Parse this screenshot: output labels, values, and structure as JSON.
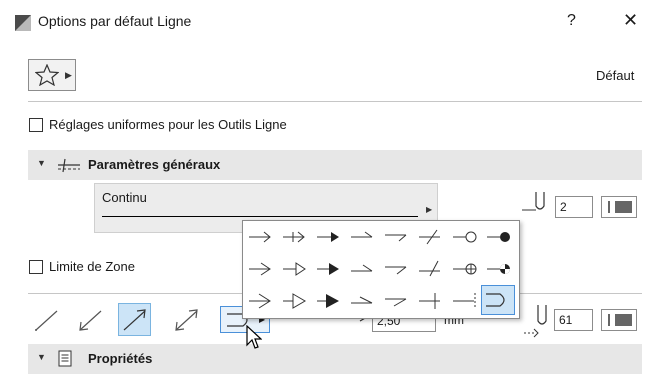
{
  "window": {
    "title": "Options par défaut Ligne",
    "help_label": "?",
    "close_label": "✕"
  },
  "favorites": {
    "icon": "star-icon"
  },
  "header": {
    "profile_label": "Défaut"
  },
  "uniform_checkbox": {
    "label": "Réglages uniformes pour les Outils Ligne",
    "checked": false
  },
  "general_section": {
    "title": "Paramètres généraux",
    "icon": "line-params-icon"
  },
  "line_type": {
    "name": "Continu"
  },
  "pen_top": {
    "value": "2"
  },
  "zone_checkbox": {
    "label": "Limite de Zone",
    "checked": false
  },
  "arrow_size": {
    "value": "2,50",
    "unit": "mm"
  },
  "pen_bottom": {
    "value": "61"
  },
  "properties_section": {
    "title": "Propriétés",
    "icon": "document-icon"
  },
  "colors": {
    "selection": "#cce4f7",
    "section_bg": "#e7e7e7",
    "pen_swatch": "#666666"
  }
}
